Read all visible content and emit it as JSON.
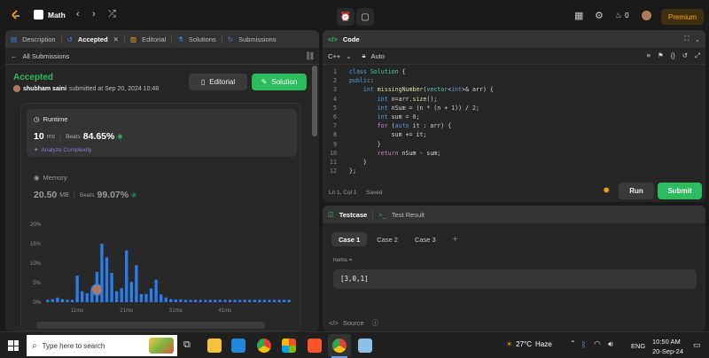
{
  "topbar": {
    "title": "Math",
    "premium_label": "Premium",
    "fire_count": "0"
  },
  "left": {
    "tabs": [
      {
        "label": "Description"
      },
      {
        "label": "Accepted"
      },
      {
        "label": "Editorial"
      },
      {
        "label": "Solutions"
      },
      {
        "label": "Submissions"
      }
    ],
    "back_label": "All Submissions",
    "status": "Accepted",
    "user": "shubham saini",
    "submitted_text": "submitted at Sep 20, 2024 10:48",
    "editorial_btn": "Editorial",
    "solution_btn": "Solution",
    "runtime": {
      "label": "Runtime",
      "value": "10",
      "unit": "ms",
      "beats_label": "Beats",
      "beats": "84.65%",
      "analyze": "Analyze Complexity"
    },
    "memory": {
      "label": "Memory",
      "value": "20.50",
      "unit": "MB",
      "beats_label": "Beats",
      "beats": "99.07%"
    }
  },
  "chart_data": {
    "type": "bar",
    "y_ticks": [
      "20%",
      "15%",
      "10%",
      "5%",
      "0%"
    ],
    "x_ticks": [
      "11ms",
      "21ms",
      "31ms",
      "41ms"
    ],
    "ylim": [
      0,
      20
    ],
    "values": [
      0.6,
      0.8,
      1.2,
      0.8,
      0.6,
      0.6,
      6.8,
      2.8,
      2.3,
      3.2,
      7.8,
      15,
      11.5,
      7.5,
      2.8,
      3.6,
      13.3,
      5.2,
      9.5,
      2.1,
      2.1,
      3.5,
      5.8,
      2.0,
      1.2,
      0.8,
      0.7,
      0.7,
      0.6,
      0.6,
      0.6,
      0.6,
      0.6,
      0.6,
      0.6,
      0.6,
      0.6,
      0.6,
      0.6,
      0.6,
      0.6,
      0.6,
      0.6,
      0.6,
      0.6,
      0.6,
      0.6,
      0.6,
      0.6,
      0.6
    ],
    "highlight_index": 10,
    "color": "#2b7de9"
  },
  "code": {
    "title": "Code",
    "language": "C++",
    "mode": "Auto",
    "status_left": "Ln 1, Col 1",
    "status_saved": "Saved",
    "run_label": "Run",
    "submit_label": "Submit",
    "lines": [
      "class Solution {",
      "public:",
      "    int missingNumber(vector<int>& arr) {",
      "        int n=arr.size();",
      "        int nSum = (n * (n + 1)) / 2;",
      "        int sum = 0;",
      "        for (auto it : arr) {",
      "            sum += it;",
      "        }",
      "        return nSum - sum;",
      "    }",
      "};"
    ]
  },
  "testcase": {
    "tab_label": "Testcase",
    "result_label": "Test Result",
    "cases": [
      "Case 1",
      "Case 2",
      "Case 3"
    ],
    "add": "+",
    "var_label": "nums =",
    "var_value": "[3,0,1]",
    "source_label": "Source"
  },
  "taskbar": {
    "search_placeholder": "Type here to search",
    "temperature": "27°C",
    "weather": "Haze",
    "lang": "ENG",
    "time": "10:50 AM",
    "date": "20-Sep-24"
  }
}
